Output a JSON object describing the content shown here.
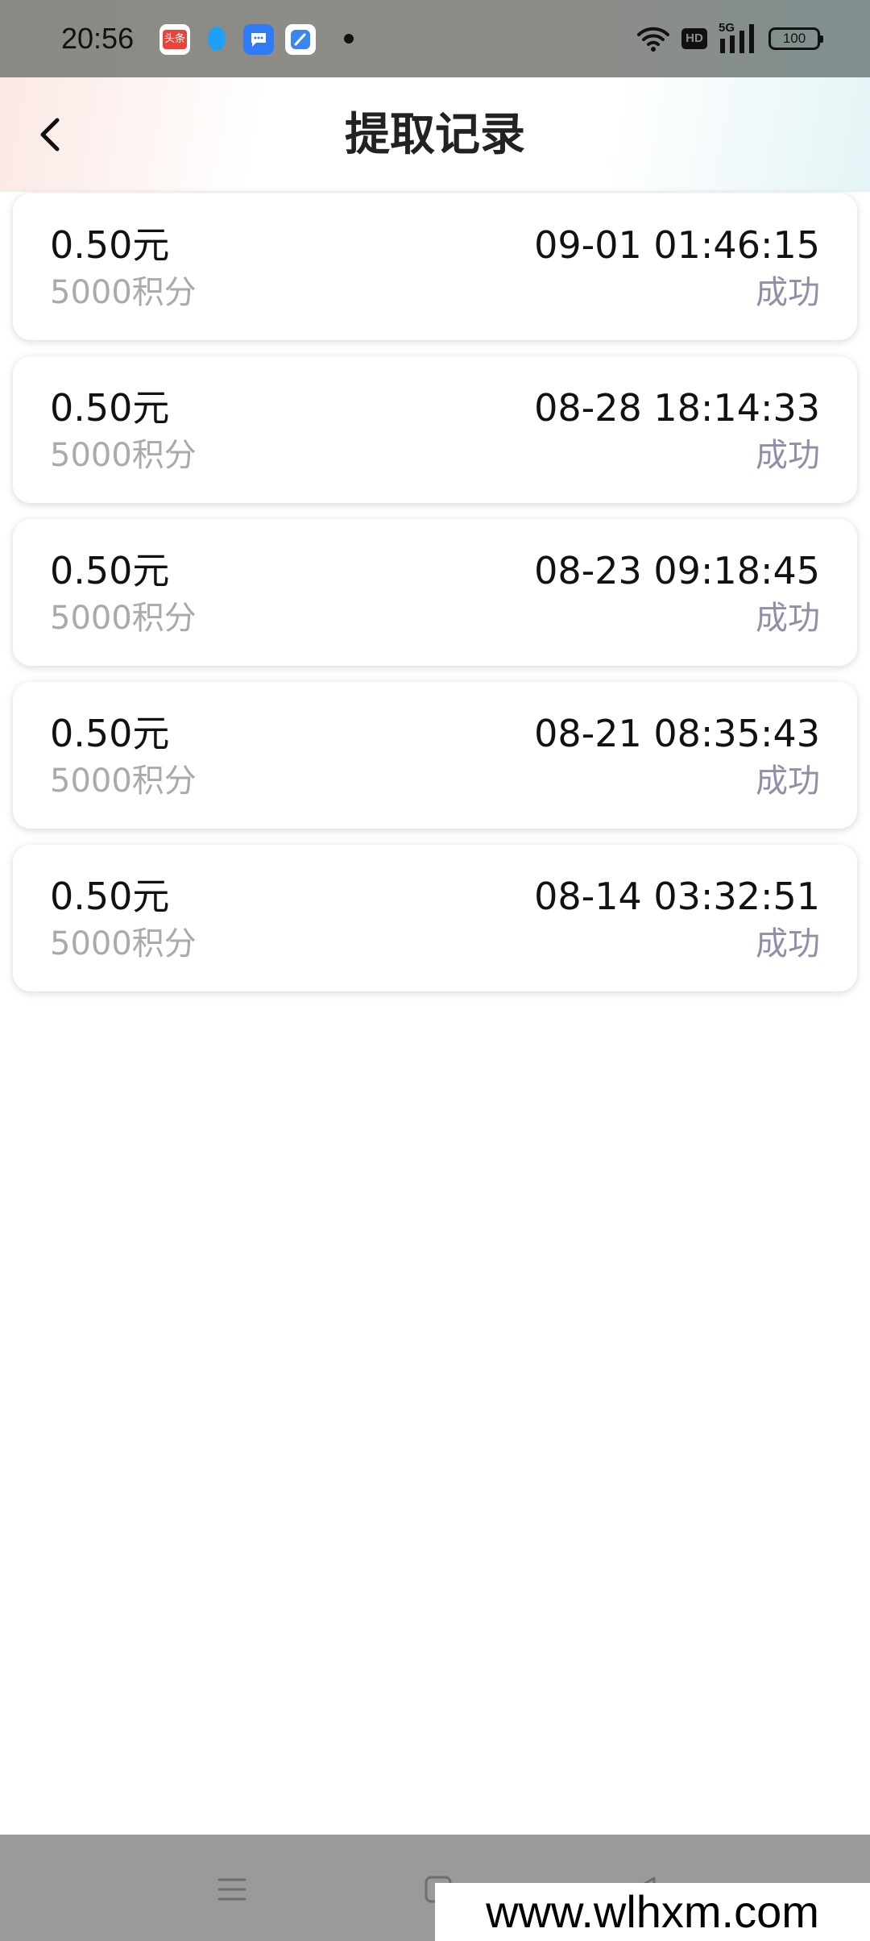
{
  "status_bar": {
    "time": "20:56",
    "notifications": [
      {
        "icon": "toutiao-app-icon",
        "label": "头条",
        "color": "#e8443a"
      },
      {
        "icon": "qq-icon",
        "color": "#1ea0f5"
      },
      {
        "icon": "message-app-icon",
        "color": "#2f7bf6"
      },
      {
        "icon": "browser-app-icon",
        "color": "#3a86f0"
      }
    ],
    "hd_label": "HD",
    "network_label": "5G",
    "battery_level": "100"
  },
  "header": {
    "title": "提取记录"
  },
  "records": [
    {
      "amount": "0.50元",
      "points": "5000积分",
      "time": "09-01 01:46:15",
      "status": "成功"
    },
    {
      "amount": "0.50元",
      "points": "5000积分",
      "time": "08-28 18:14:33",
      "status": "成功"
    },
    {
      "amount": "0.50元",
      "points": "5000积分",
      "time": "08-23 09:18:45",
      "status": "成功"
    },
    {
      "amount": "0.50元",
      "points": "5000积分",
      "time": "08-21 08:35:43",
      "status": "成功"
    },
    {
      "amount": "0.50元",
      "points": "5000积分",
      "time": "08-14 03:32:51",
      "status": "成功"
    }
  ],
  "watermark": "www.wlhxm.com",
  "colors": {
    "status_success": "#8f8fa8",
    "points_text": "#aaaaaa",
    "nav_bar": "#9a9a9a"
  }
}
